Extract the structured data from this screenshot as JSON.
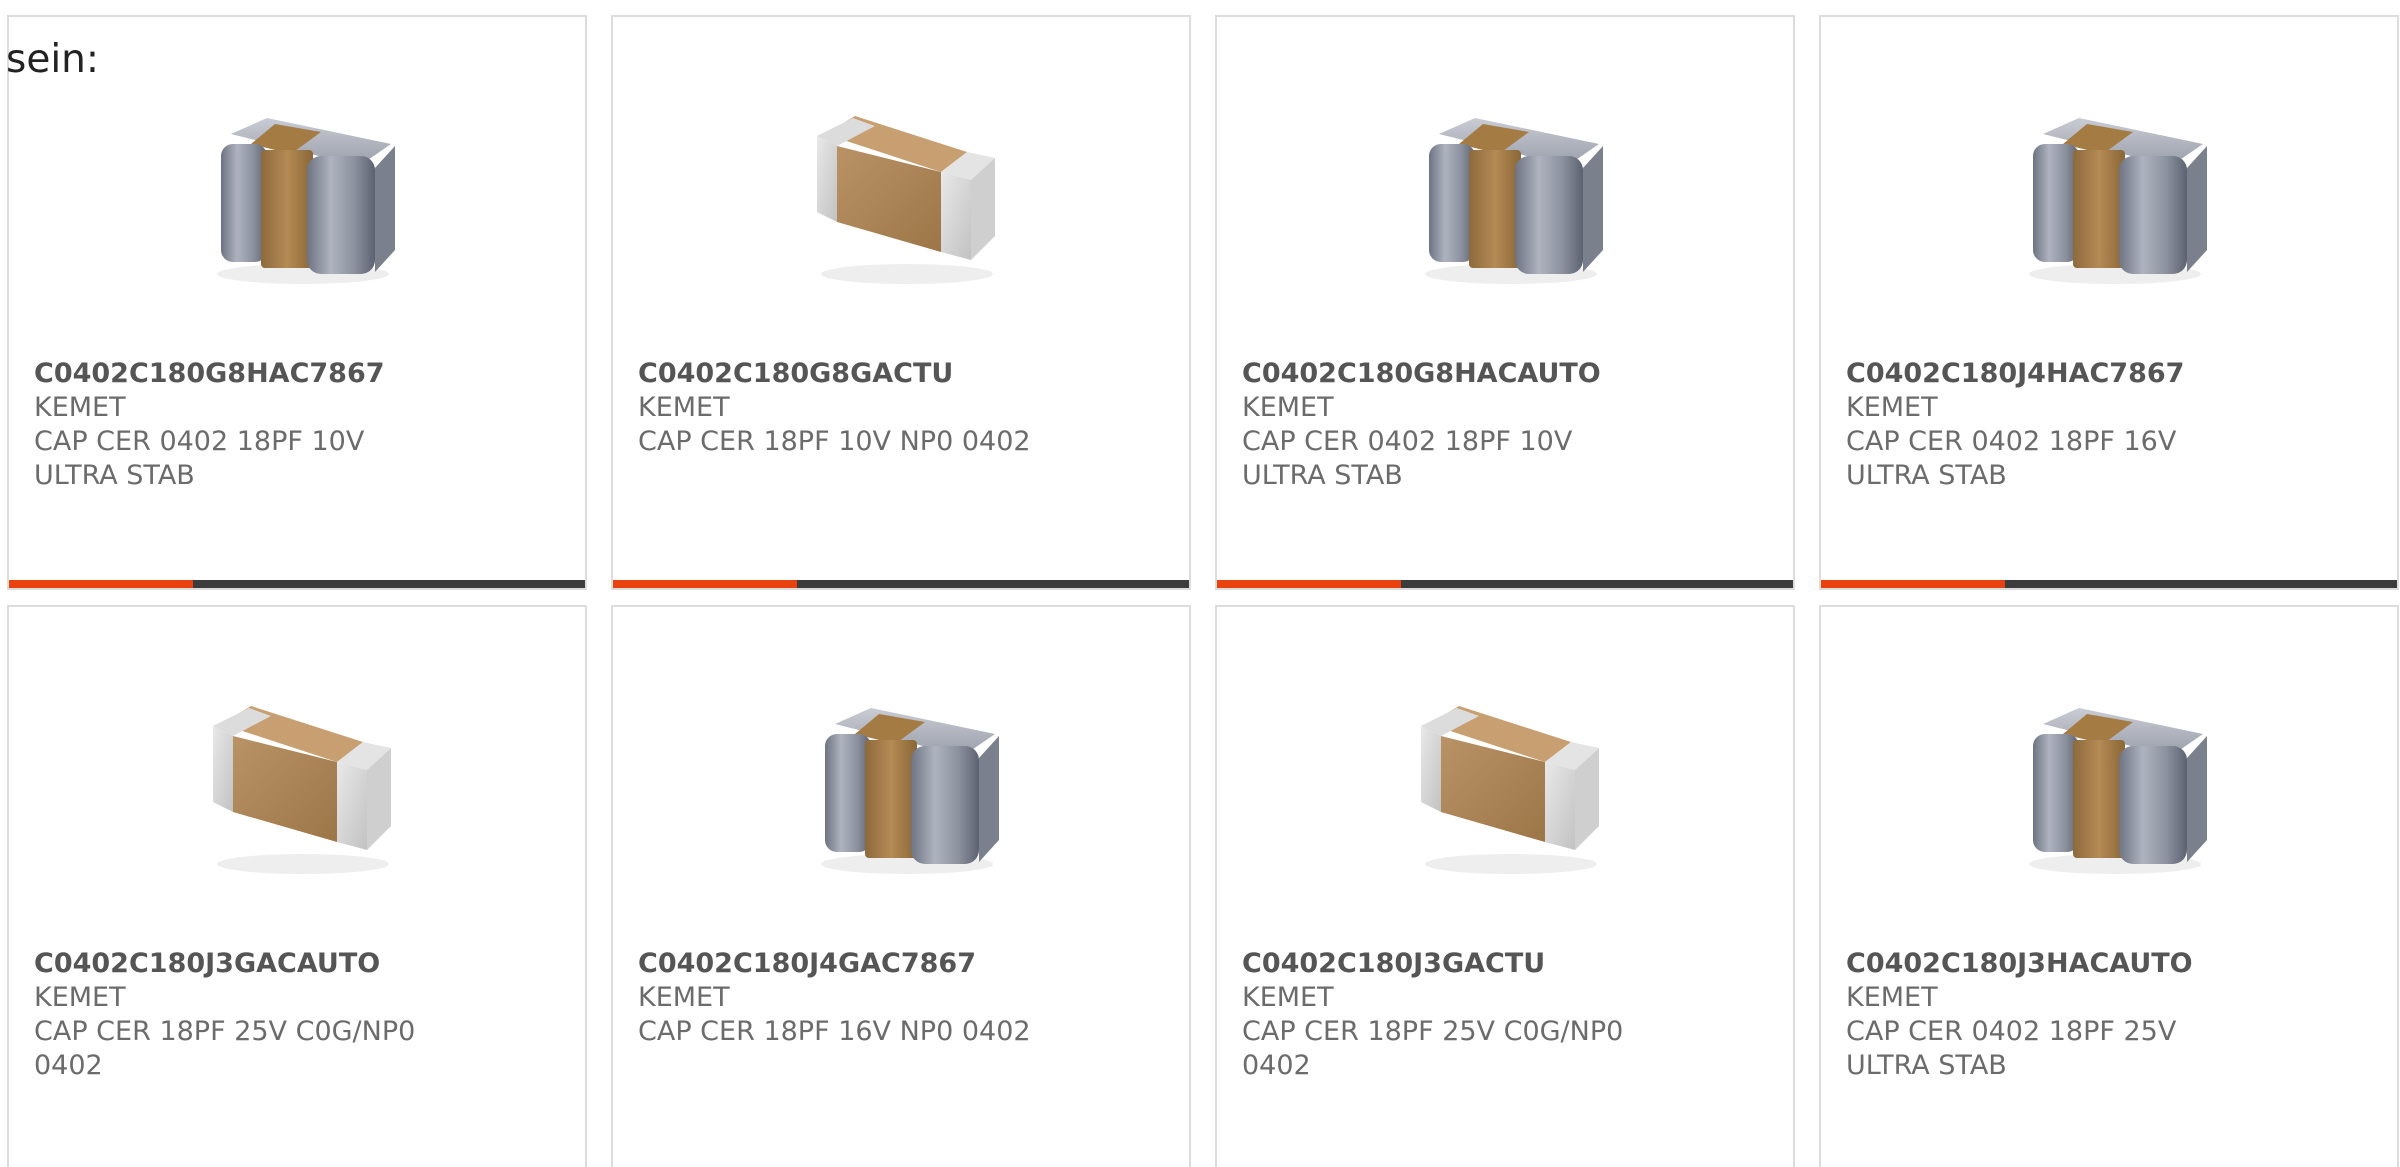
{
  "intro_text": "sein:",
  "accent_color": "#e8420f",
  "bar_track_color": "#3c3c3c",
  "products": [
    {
      "part_number": "C0402C180G8HAC7867",
      "manufacturer": "KEMET",
      "description": "CAP CER 0402 18PF 10V ULTRA STAB",
      "image": "capacitor-ultra-stab-icon",
      "progress": 0.32
    },
    {
      "part_number": "C0402C180G8GACTU",
      "manufacturer": "KEMET",
      "description": "CAP CER 18PF 10V NP0 0402",
      "image": "capacitor-np0-icon",
      "progress": 0.32
    },
    {
      "part_number": "C0402C180G8HACAUTO",
      "manufacturer": "KEMET",
      "description": "CAP CER 0402 18PF 10V ULTRA STAB",
      "image": "capacitor-ultra-stab-icon",
      "progress": 0.32
    },
    {
      "part_number": "C0402C180J4HAC7867",
      "manufacturer": "KEMET",
      "description": "CAP CER 0402 18PF 16V ULTRA STAB",
      "image": "capacitor-ultra-stab-icon",
      "progress": 0.32
    },
    {
      "part_number": "C0402C180J3GACAUTO",
      "manufacturer": "KEMET",
      "description": "CAP CER 18PF 25V C0G/NP0 0402",
      "image": "capacitor-np0-icon"
    },
    {
      "part_number": "C0402C180J4GAC7867",
      "manufacturer": "KEMET",
      "description": "CAP CER 18PF 16V NP0 0402",
      "image": "capacitor-ultra-stab-icon"
    },
    {
      "part_number": "C0402C180J3GACTU",
      "manufacturer": "KEMET",
      "description": "CAP CER 18PF 25V C0G/NP0 0402",
      "image": "capacitor-np0-icon"
    },
    {
      "part_number": "C0402C180J3HACAUTO",
      "manufacturer": "KEMET",
      "description": "CAP CER 0402 18PF 25V ULTRA STAB",
      "image": "capacitor-ultra-stab-icon"
    }
  ]
}
